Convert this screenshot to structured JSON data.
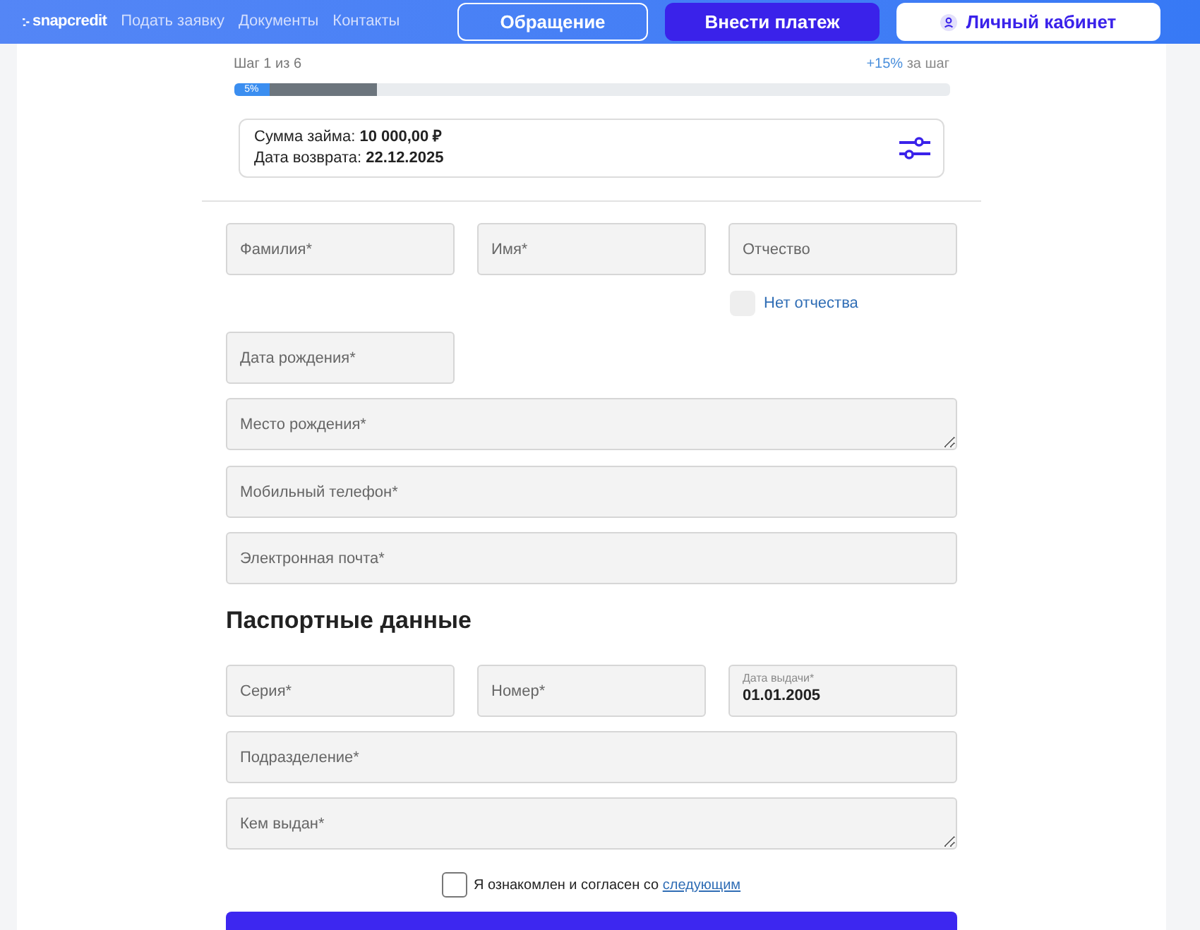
{
  "header": {
    "logo": "snapcredit",
    "nav": [
      "Подать заявку",
      "Документы",
      "Контакты"
    ],
    "buttons": [
      {
        "label": "Обращение",
        "kind": "outline"
      },
      {
        "label": "Внести платеж",
        "kind": "primary"
      },
      {
        "label": "Личный кабинет",
        "kind": "account"
      }
    ]
  },
  "progress": {
    "step": "Шаг 1 из 6",
    "bonus": "+15%",
    "bonus_note": "за шаг",
    "segments": [
      {
        "kind": "current",
        "label": "5%",
        "level": 0.05
      },
      {
        "kind": "next",
        "level": 0.15
      }
    ]
  },
  "loan_summary": {
    "lines": [
      "Сумма займа: **10 000,00 ₽**",
      "Дата возврата: **22.12.2025**"
    ]
  },
  "personal_form": [
    {
      "kind": "row",
      "fields": [
        {
          "placeholder": "Фамилия*"
        },
        {
          "placeholder": "Имя*"
        },
        {
          "placeholder": "Отчество"
        }
      ]
    },
    {
      "kind": "check",
      "label": "Нет отчества",
      "checked": false
    },
    {
      "kind": "row",
      "fields": [
        {
          "placeholder": "Дата рождения*"
        }
      ]
    },
    {
      "kind": "textarea",
      "placeholder": "Место рождения*"
    },
    {
      "kind": "input",
      "placeholder": "Мобильный телефон*"
    },
    {
      "kind": "input",
      "placeholder": "Электронная почта*"
    }
  ],
  "passport": {
    "title": "Паспортные данные",
    "items": [
      {
        "kind": "row",
        "fields": [
          {
            "placeholder": "Серия*"
          },
          {
            "placeholder": "Номер*"
          },
          {
            "label": "Дата выдачи*",
            "value": "01.01.2005"
          }
        ]
      },
      {
        "kind": "input",
        "placeholder": "Подразделение*"
      },
      {
        "kind": "textarea",
        "placeholder": "Кем выдан*"
      }
    ]
  },
  "agreement": {
    "text": "Я ознакомлен и согласен со",
    "link": "следующим",
    "checked": false
  }
}
